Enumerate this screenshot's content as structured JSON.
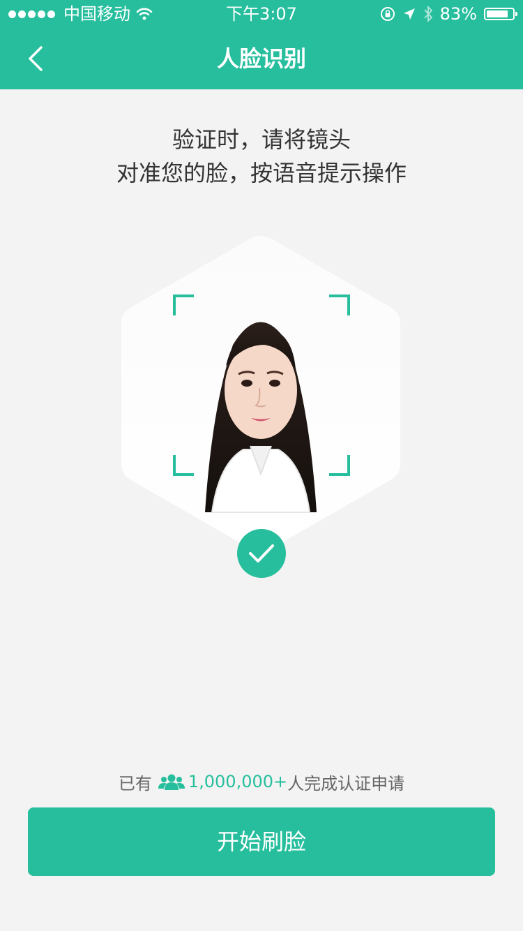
{
  "status_bar": {
    "carrier": "中国移动",
    "time": "下午3:07",
    "battery": "83%",
    "battery_level": 0.83,
    "icons": [
      "signal-dots-icon",
      "wifi-icon",
      "rotation-lock-icon",
      "location-icon",
      "bluetooth-icon",
      "battery-icon"
    ]
  },
  "nav": {
    "title": "人脸识别",
    "back_icon": "chevron-left-icon"
  },
  "instruction": {
    "line1": "验证时，请将镜头",
    "line2": "对准您的脸，按语音提示操作"
  },
  "face_area": {
    "icon": "check-icon"
  },
  "stats": {
    "prefix": "已有",
    "count": "1,000,000+",
    "suffix": "人完成认证申请",
    "icon": "users-icon"
  },
  "button": {
    "label": "开始刷脸"
  },
  "colors": {
    "accent": "#26be9d",
    "background": "#f2f3f2",
    "text": "#333333",
    "muted_text": "#666666"
  }
}
